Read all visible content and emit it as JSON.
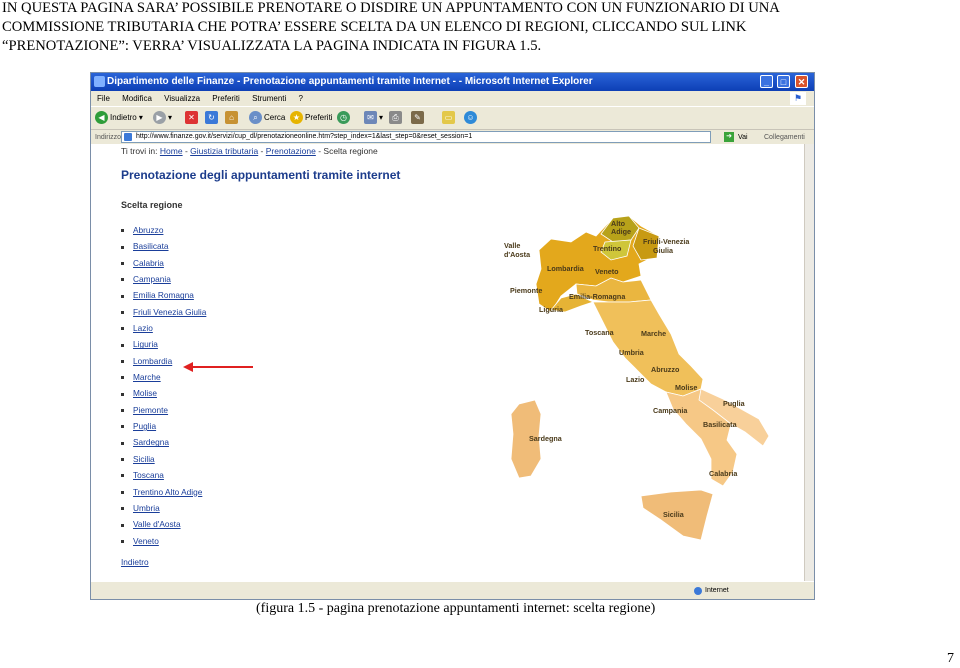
{
  "intro": {
    "line1": "IN QUESTA PAGINA SARA’ POSSIBILE PRENOTARE O DISDIRE UN APPUNTAMENTO CON UN FUNZIONARIO DI UNA",
    "line2": "COMMISSIONE TRIBUTARIA CHE POTRA’ ESSERE SCELTA DA UN ELENCO DI REGIONI, CLICCANDO SUL LINK",
    "line3": "“PRENOTAZIONE”: VERRA’ VISUALIZZATA LA PAGINA INDICATA IN FIGURA 1.5."
  },
  "browser": {
    "window_title": "Dipartimento delle Finanze - Prenotazione appuntamenti tramite Internet - - Microsoft Internet Explorer",
    "window_buttons": [
      "_",
      "□",
      "✕"
    ],
    "menu": [
      "File",
      "Modifica",
      "Visualizza",
      "Preferiti",
      "Strumenti",
      "?"
    ],
    "toolbar": {
      "back": "Indietro",
      "search": "Cerca",
      "favorites": "Preferiti"
    },
    "address_label": "Indirizzo",
    "address_value": "http://www.finanze.gov.it/servizi/cup_dl/prenotazioneonline.htm?step_index=1&last_step=0&reset_session=1",
    "go_label": "Vai",
    "links_label": "Collegamenti",
    "status_zone": "Internet"
  },
  "page": {
    "breadcrumb": {
      "prefix": "Ti trovi in:",
      "home": "Home",
      "sep": " - ",
      "giustizia": "Giustizia tributaria",
      "prenotazione": "Prenotazione",
      "current": "Scelta regione"
    },
    "title": "Prenotazione degli appuntamenti tramite internet",
    "subtitle": "Scelta regione",
    "regions": [
      "Abruzzo",
      "Basilicata",
      "Calabria",
      "Campania",
      "Emilia Romagna",
      "Friuli Venezia Giulia",
      "Lazio",
      "Liguria",
      "Lombardia",
      "Marche",
      "Molise",
      "Piemonte",
      "Puglia",
      "Sardegna",
      "Sicilia",
      "Toscana",
      "Trentino Alto Adige",
      "Umbria",
      "Valle d'Aosta",
      "Veneto"
    ],
    "highlighted_region": "Lombardia",
    "back_link": "Indietro"
  },
  "map": {
    "labels": {
      "valle": [
        "Valle",
        "d'Aosta"
      ],
      "alto": [
        "Alto",
        "Adige"
      ],
      "trentino": "Trentino",
      "friuli": [
        "Friuli-Venezia",
        "Giulia"
      ],
      "lombardia": "Lombardia",
      "veneto": "Veneto",
      "piemonte": "Piemonte",
      "emilia": "Emilia-Romagna",
      "liguria": "Liguria",
      "toscana": "Toscana",
      "marche": "Marche",
      "umbria": "Umbria",
      "abruzzo": "Abruzzo",
      "lazio": "Lazio",
      "molise": "Molise",
      "campania": "Campania",
      "puglia": "Puglia",
      "sardegna": "Sardegna",
      "basilicata": "Basilicata",
      "calabria": "Calabria",
      "sicilia": "Sicilia"
    },
    "colors": {
      "north": "#e3a81c",
      "center": "#f0c05a",
      "south": "#f6c886",
      "islands": "#f0bc78",
      "accent_arrow": "#e02020"
    }
  },
  "caption": "(figura 1.5 - pagina prenotazione appuntamenti internet: scelta regione)",
  "page_number": "7"
}
